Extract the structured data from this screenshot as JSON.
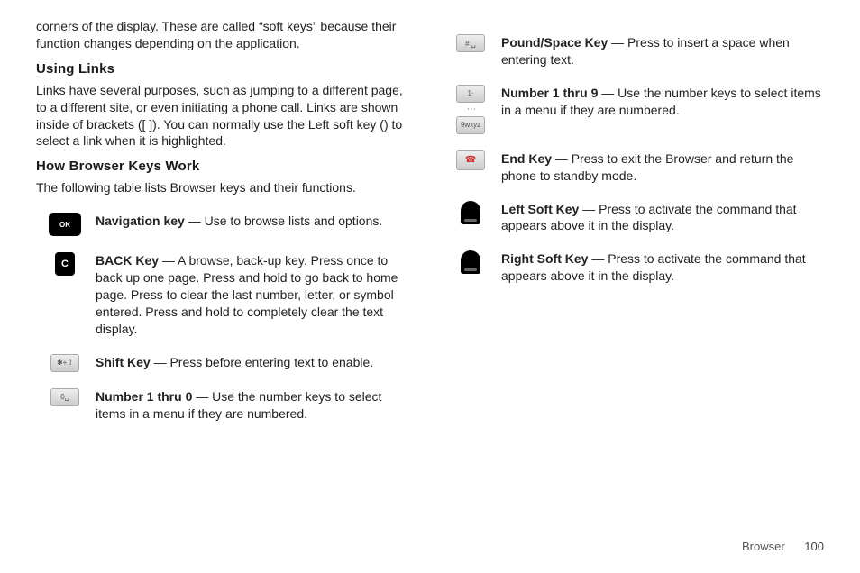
{
  "left": {
    "intro": "corners of the display. These are called “soft keys” because their function changes depending on the application.",
    "heading_links": "Using Links",
    "links_para": "Links have several purposes, such as jumping to a different page, to a different site, or even initiating a phone call. Links are shown inside of brackets ([ ]). You can normally use the Left soft key () to select a link when it is highlighted.",
    "heading_keys": "How Browser Keys Work",
    "keys_para": "The following table lists Browser keys and their functions.",
    "items": [
      {
        "label": "Navigation key",
        "desc": " — Use to browse lists and options."
      },
      {
        "label": "BACK Key",
        "desc": " — A browse, back-up key. Press once to back up one page. Press and hold to go back to home page. Press to clear the last number, letter, or symbol entered. Press and hold to completely clear the text display."
      },
      {
        "label": "Shift Key",
        "desc": " — Press before entering text to enable."
      },
      {
        "label": "Number 1 thru 0",
        "desc": " — Use the number keys to select items in a menu if they are numbered."
      }
    ]
  },
  "right": {
    "items": [
      {
        "label": "Pound/Space Key",
        "desc": " — Press to insert a space when entering text."
      },
      {
        "label": "Number 1 thru 9",
        "desc": " — Use the number keys to select items in a menu if they are numbered."
      },
      {
        "label": "End Key",
        "desc": " — Press to exit the Browser and return the phone to standby mode."
      },
      {
        "label": "Left Soft Key",
        "desc": " — Press to activate the command that appears above it in the display."
      },
      {
        "label": "Right Soft Key",
        "desc": " — Press to activate the command that appears above it in the display."
      }
    ]
  },
  "icons": {
    "ok": "OK",
    "c": "C",
    "shift": "✱+⇧",
    "zero": "0␣",
    "pound": "# ␣",
    "one": "1·",
    "nine": "9wxyz",
    "end": "☎"
  },
  "footer": {
    "section": "Browser",
    "page": "100"
  }
}
